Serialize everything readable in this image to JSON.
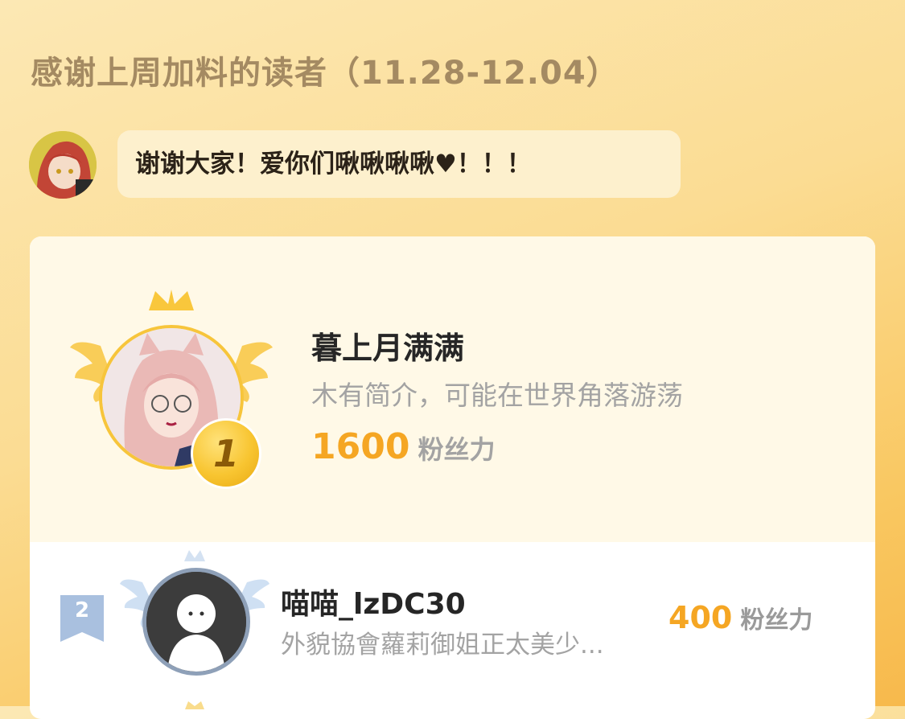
{
  "header": {
    "title": "感谢上周加料的读者（11.28-12.04）"
  },
  "host": {
    "message": "谢谢大家！爱你们啾啾啾啾♥！！！"
  },
  "leaderboard": {
    "entries": [
      {
        "rank": "1",
        "name": "暮上月满满",
        "description": "木有简介，可能在世界角落游荡",
        "score": "1600",
        "unit": "粉丝力"
      },
      {
        "rank": "2",
        "name": "喵喵_lzDC30",
        "description": "外貌協會蘿莉御姐正太美少...",
        "score": "400",
        "unit": "粉丝力"
      }
    ]
  },
  "colors": {
    "accent": "#f5a623",
    "gold": "#f7c53b",
    "silver": "#8ea0b8",
    "title": "#a48a62"
  },
  "icons": [
    "crown-icon",
    "wings-icon",
    "medal-icon",
    "rank-badge-icon"
  ]
}
